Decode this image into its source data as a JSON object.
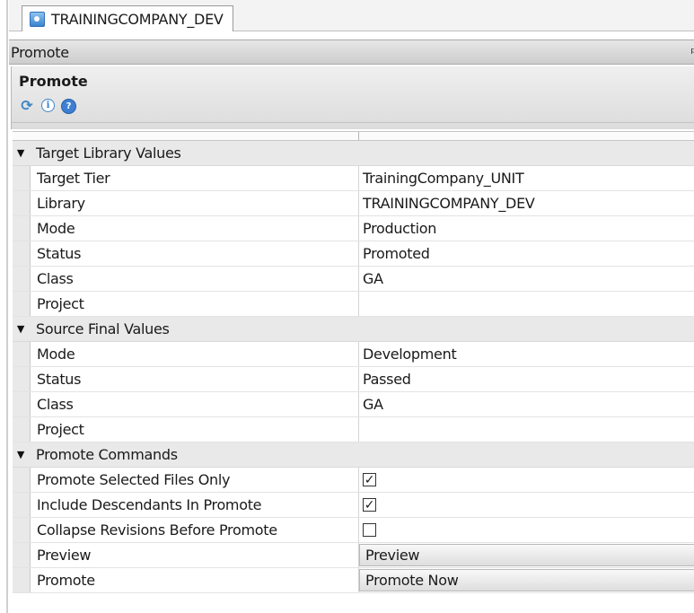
{
  "tab": {
    "title": "TRAININGCOMPANY_DEV",
    "icon": "document-icon"
  },
  "panel": {
    "title": "Promote",
    "pin_icon": "pin-icon"
  },
  "header": {
    "title": "Promote",
    "icons": [
      "refresh-icon",
      "info-icon",
      "help-icon"
    ]
  },
  "sections": {
    "target": {
      "label": "Target Library Values",
      "rows": [
        {
          "name": "Target Tier",
          "value": "TrainingCompany_UNIT"
        },
        {
          "name": "Library",
          "value": "TRAININGCOMPANY_DEV"
        },
        {
          "name": "Mode",
          "value": "Production"
        },
        {
          "name": "Status",
          "value": "Promoted"
        },
        {
          "name": "Class",
          "value": "GA"
        },
        {
          "name": "Project",
          "value": ""
        }
      ]
    },
    "source": {
      "label": "Source Final Values",
      "rows": [
        {
          "name": "Mode",
          "value": "Development"
        },
        {
          "name": "Status",
          "value": "Passed"
        },
        {
          "name": "Class",
          "value": "GA"
        },
        {
          "name": "Project",
          "value": ""
        }
      ]
    },
    "commands": {
      "label": "Promote Commands",
      "checkboxes": [
        {
          "name": "Promote Selected Files Only",
          "checked": true
        },
        {
          "name": "Include Descendants In Promote",
          "checked": true
        },
        {
          "name": "Collapse Revisions Before Promote",
          "checked": false
        }
      ],
      "buttons": [
        {
          "name": "Preview",
          "label": "Preview"
        },
        {
          "name": "Promote",
          "label": "Promote Now"
        }
      ]
    }
  }
}
